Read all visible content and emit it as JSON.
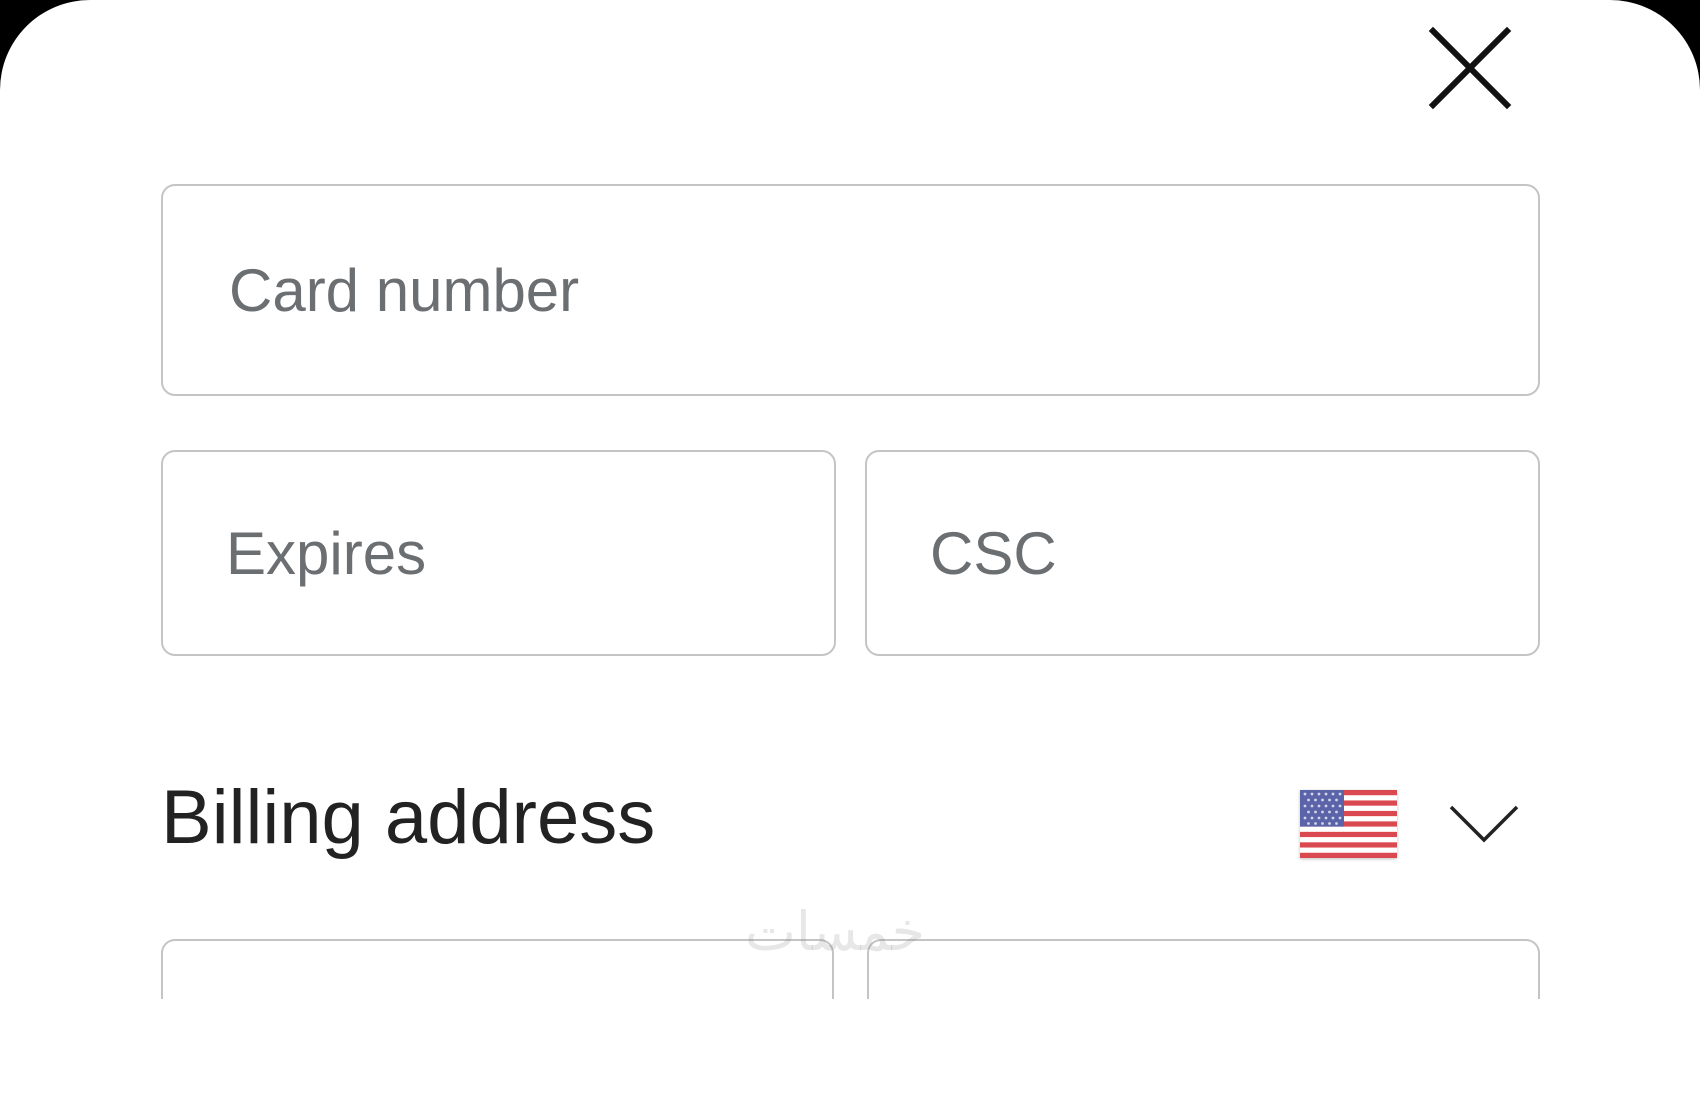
{
  "form": {
    "card_number_placeholder": "Card number",
    "expires_placeholder": "Expires",
    "csc_placeholder": "CSC"
  },
  "billing": {
    "title": "Billing address",
    "country_flag_icon": "us-flag-icon",
    "dropdown_icon": "chevron-down-icon"
  },
  "close_icon": "close-icon",
  "watermark": "خمسات",
  "colors": {
    "border": "#c4c4c4",
    "placeholder": "#6b6f72",
    "text": "#222222",
    "background": "#ffffff"
  }
}
